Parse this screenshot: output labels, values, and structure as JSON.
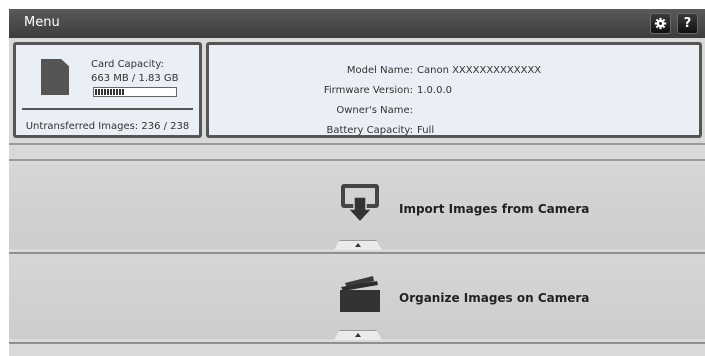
{
  "titlebar": {
    "title": "Menu",
    "settings_icon": "gear-icon",
    "help_label": "?"
  },
  "card": {
    "icon": "memory-card-icon",
    "capacity_label": "Card Capacity:",
    "capacity_value": "663 MB / 1.83 GB",
    "capacity_fraction": 0.36,
    "untransferred": "Untransferred Images: 236 / 238"
  },
  "camera": {
    "rows": [
      {
        "label": "Model Name:",
        "value": "Canon  XXXXXXXXXXXXX"
      },
      {
        "label": "Firmware Version:",
        "value": "1.0.0.0"
      },
      {
        "label": "Owner's Name:",
        "value": ""
      },
      {
        "label": "Battery Capacity:",
        "value": "Full"
      }
    ]
  },
  "actions": [
    {
      "label": "Import Images from Camera",
      "icon": "import-icon"
    },
    {
      "label": "Organize Images on Camera",
      "icon": "folder-icon"
    }
  ]
}
